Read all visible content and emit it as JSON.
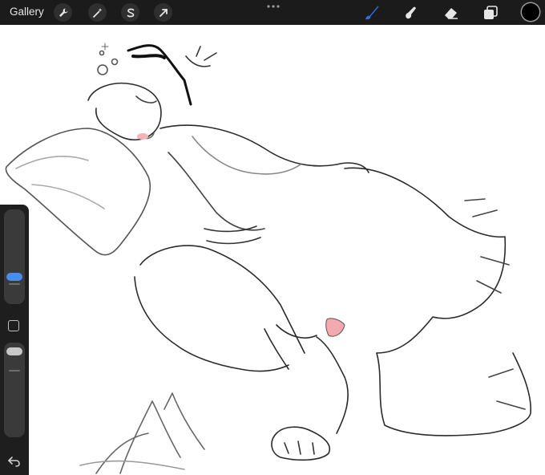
{
  "app": {
    "gallery_label": "Gallery"
  },
  "toolbar_left": [
    {
      "icon": "wrench-icon"
    },
    {
      "icon": "magic-wand-icon"
    },
    {
      "icon": "selection-s-icon"
    },
    {
      "icon": "transform-arrow-icon"
    }
  ],
  "toolbar_right": [
    {
      "icon": "brush-icon",
      "active": true
    },
    {
      "icon": "smudge-icon"
    },
    {
      "icon": "eraser-icon"
    },
    {
      "icon": "layers-icon"
    }
  ],
  "colors": {
    "topbar": "#1b1b1b",
    "active_tool": "#2f6fe0",
    "current_color": "#000000",
    "brush_size_thumb": "#4a8cf0",
    "opacity_thumb": "#c8c8c8"
  },
  "sidebar": {
    "brush_size_level": 0.3,
    "opacity_level": 0.0
  }
}
